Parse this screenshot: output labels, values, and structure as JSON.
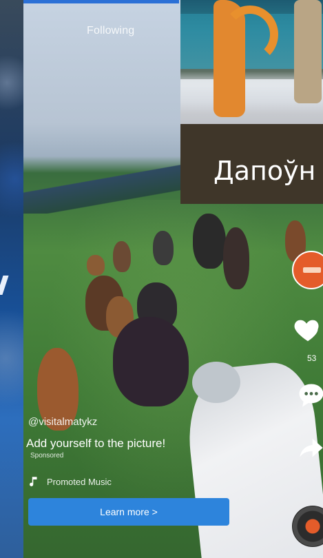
{
  "feed": {
    "header_label": "Following"
  },
  "thumbnail": {
    "title": "Дапоўн"
  },
  "post": {
    "username": "@visitalmatykz",
    "caption": "Add yourself to the picture!",
    "sponsored_label": "Sponsored",
    "music_label": "Promoted Music",
    "cta_label": "Learn more >"
  },
  "actions": {
    "like_count": "53",
    "icons": [
      "heart-icon",
      "comment-icon",
      "share-icon",
      "music-note-icon"
    ]
  },
  "colors": {
    "cta_blue": "#2d84dc",
    "avatar_orange": "#e45c2a",
    "progress_blue": "#2b70d6"
  }
}
